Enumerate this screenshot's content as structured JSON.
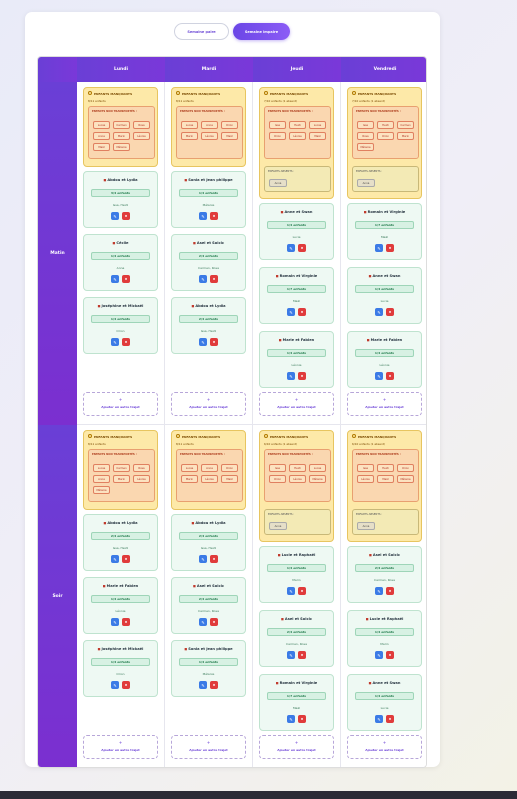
{
  "toggle": {
    "prev": "Semaine paire",
    "next": "Semaine impaire"
  },
  "days": [
    "Lundi",
    "Mardi",
    "Jeudi",
    "Vendredi"
  ],
  "slots": [
    "Matin",
    "Soir"
  ],
  "labels": {
    "missing_title": "ENFANTS MANQUANTS",
    "unassigned_title": "ENFANTS NON TRANSPORTÉS :",
    "absent_title": "ENFANTS ABSENTS :",
    "absent_chip": "Anna",
    "add_plus": "+",
    "add_label": "Ajouter un autre trajet"
  },
  "grid": [
    [
      {
        "missing": {
          "count": "8/11 enfants",
          "chips": [
            "Lucas",
            "Carmen",
            "Rosa",
            "Anna",
            "Marin",
            "Léonie",
            "Maël",
            "Mélanie"
          ],
          "absent": false
        },
        "trips": [
          {
            "name": "Abdou et Lydia",
            "count": "3/4 enfants",
            "children": "Issa, Heidi"
          },
          {
            "name": "Cécile",
            "count": "1/4 enfants",
            "children": "Anna"
          },
          {
            "name": "Joséphine et Mickaël",
            "count": "1/4 enfants",
            "children": "Orion"
          }
        ]
      },
      {
        "missing": {
          "count": "8/11 enfants",
          "chips": [
            "Lucas",
            "Anna",
            "Orion",
            "Marin",
            "Léonie",
            "Maël"
          ],
          "absent": false
        },
        "trips": [
          {
            "name": "Sonia et Jean philippe",
            "count": "1/4 enfants",
            "children": "Mélanie"
          },
          {
            "name": "Asel et Solcic",
            "count": "2/4 enfants",
            "children": "Carmen, Rosa"
          },
          {
            "name": "Abdou et Lydia",
            "count": "2/4 enfants",
            "children": "Issa, Heidi"
          }
        ]
      },
      {
        "missing": {
          "count": "7/10 enfants (1 absent)",
          "chips": [
            "Issa",
            "Heidi",
            "Lucas",
            "Orion",
            "Léonie",
            "Maël"
          ],
          "absent": true
        },
        "trips": [
          {
            "name": "Anne et Swan",
            "count": "1/4 enfants",
            "children": "Lucie"
          },
          {
            "name": "Romain et Virginie",
            "count": "1/7 enfants",
            "children": "Maël"
          },
          {
            "name": "Marie et Fabien",
            "count": "1/4 enfants",
            "children": "Léonie"
          }
        ]
      },
      {
        "missing": {
          "count": "7/10 enfants (1 absent)",
          "chips": [
            "Issa",
            "Heidi",
            "Carmen",
            "Rosa",
            "Orion",
            "Marin",
            "Mélanie"
          ],
          "absent": true
        },
        "trips": [
          {
            "name": "Romain et Virginie",
            "count": "1/7 enfants",
            "children": "Maël"
          },
          {
            "name": "Anne et Swan",
            "count": "1/4 enfants",
            "children": "Lucie"
          },
          {
            "name": "Marie et Fabien",
            "count": "1/4 enfants",
            "children": "Léonie"
          }
        ]
      }
    ],
    [
      {
        "missing": {
          "count": "8/11 enfants",
          "chips": [
            "Lucas",
            "Carmen",
            "Rosa",
            "Anna",
            "Marin",
            "Léonie",
            "Mélanie"
          ],
          "absent": false
        },
        "trips": [
          {
            "name": "Abdou et Lydia",
            "count": "2/4 enfants",
            "children": "Issa, Heidi"
          },
          {
            "name": "Marie et Fabien",
            "count": "1/4 enfants",
            "children": "Léonie"
          },
          {
            "name": "Joséphine et Mickaël",
            "count": "1/4 enfants",
            "children": "Orion"
          }
        ]
      },
      {
        "missing": {
          "count": "8/11 enfants",
          "chips": [
            "Lucas",
            "Anna",
            "Orion",
            "Marin",
            "Léonie",
            "Maël"
          ],
          "absent": false
        },
        "trips": [
          {
            "name": "Abdou et Lydia",
            "count": "2/4 enfants",
            "children": "Issa, Heidi"
          },
          {
            "name": "Asel et Solcic",
            "count": "2/4 enfants",
            "children": "Carmen, Rosa"
          },
          {
            "name": "Sonia et Jean philippe",
            "count": "1/4 enfants",
            "children": "Mélanie"
          }
        ]
      },
      {
        "missing": {
          "count": "6/10 enfants (1 absent)",
          "chips": [
            "Issa",
            "Heidi",
            "Lucas",
            "Orion",
            "Léonie",
            "Mélanie"
          ],
          "absent": true
        },
        "trips": [
          {
            "name": "Lucie et Raphaël",
            "count": "1/4 enfants",
            "children": "Marin"
          },
          {
            "name": "Asel et Solcic",
            "count": "2/4 enfants",
            "children": "Carmen, Rosa"
          },
          {
            "name": "Romain et Virginie",
            "count": "1/7 enfants",
            "children": "Maël"
          }
        ]
      },
      {
        "missing": {
          "count": "6/10 enfants (1 absent)",
          "chips": [
            "Issa",
            "Heidi",
            "Orion",
            "Léonie",
            "Maël",
            "Mélanie"
          ],
          "absent": true
        },
        "trips": [
          {
            "name": "Asel et Solcic",
            "count": "2/4 enfants",
            "children": "Carmen, Rosa"
          },
          {
            "name": "Lucie et Raphaël",
            "count": "1/4 enfants",
            "children": "Marin"
          },
          {
            "name": "Anne et Swan",
            "count": "1/4 enfants",
            "children": "Lucie"
          }
        ]
      }
    ]
  ]
}
